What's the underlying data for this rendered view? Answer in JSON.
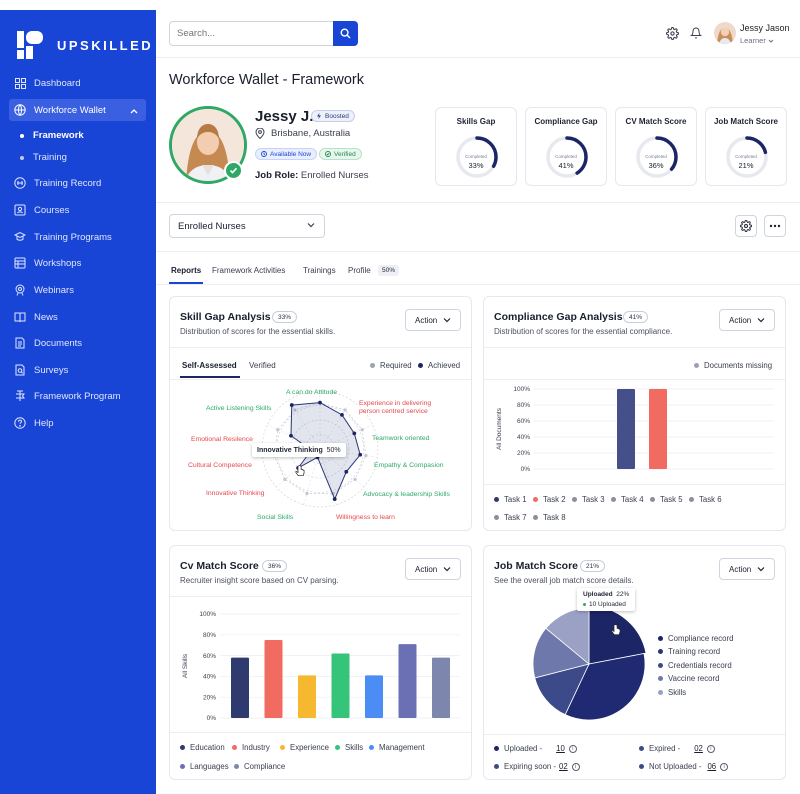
{
  "app": {
    "name": "UPSKILLED"
  },
  "sidebar": {
    "items": [
      {
        "label": "Dashboard",
        "icon": "dashboard-icon"
      },
      {
        "label": "Workforce Wallet",
        "icon": "wallet-icon"
      },
      {
        "label": "Framework"
      },
      {
        "label": "Training"
      },
      {
        "label": "Training Record",
        "icon": "record-icon"
      },
      {
        "label": "Courses",
        "icon": "courses-icon"
      },
      {
        "label": "Training Programs",
        "icon": "programs-icon"
      },
      {
        "label": "Workshops",
        "icon": "workshops-icon"
      },
      {
        "label": "Webinars",
        "icon": "webinars-icon"
      },
      {
        "label": "News",
        "icon": "news-icon"
      },
      {
        "label": "Documents",
        "icon": "documents-icon"
      },
      {
        "label": "Surveys",
        "icon": "surveys-icon"
      },
      {
        "label": "Framework Program",
        "icon": "framework-program-icon"
      },
      {
        "label": "Help",
        "icon": "help-icon"
      }
    ]
  },
  "header": {
    "search_placeholder": "Search...",
    "user": {
      "name": "Jessy Jason",
      "role": "Learner"
    }
  },
  "page": {
    "title": "Workforce Wallet - Framework"
  },
  "profile": {
    "name": "Jessy J.",
    "boosted": "Boosted",
    "location": "Brisbane, Australia",
    "available": "Available Now",
    "verified": "Verified",
    "job_role_label": "Job Role:",
    "job_role": "Enrolled Nurses"
  },
  "gauges": [
    {
      "title": "Skills Gap",
      "caption": "Completed",
      "value": "33%",
      "fraction": 0.33
    },
    {
      "title": "Compliance Gap",
      "caption": "Completed",
      "value": "41%",
      "fraction": 0.41
    },
    {
      "title": "CV Match Score",
      "caption": "Completed",
      "value": "36%",
      "fraction": 0.36
    },
    {
      "title": "Job Match Score",
      "caption": "Completed",
      "value": "21%",
      "fraction": 0.21
    }
  ],
  "filter": {
    "selected": "Enrolled Nurses"
  },
  "tabs": [
    {
      "label": "Reports"
    },
    {
      "label": "Framework Activities"
    },
    {
      "label": "Trainings"
    },
    {
      "label": "Profile",
      "badge": "50%"
    }
  ],
  "skill_gap": {
    "title": "Skill Gap Analysis",
    "badge": "33%",
    "subtitle": "Distribution of scores for the essential skills.",
    "action": "Action",
    "subtabs": [
      "Self-Assessed",
      "Verified"
    ],
    "legend": [
      "Required",
      "Achieved"
    ],
    "tooltip_label": "Innovative Thinking",
    "tooltip_value": "50%",
    "labels": [
      {
        "text": "A can do Attitude",
        "color": "#2fa866"
      },
      {
        "text": "Experience in delivering",
        "color": "#e5484d"
      },
      {
        "text": "person centred service",
        "color": "#e5484d"
      },
      {
        "text": "Teamwork oriented",
        "color": "#2fa866"
      },
      {
        "text": "Empathy & Compasion",
        "color": "#2fa866"
      },
      {
        "text": "Advocacy & leadership Skills",
        "color": "#2fa866"
      },
      {
        "text": "Willingness to learn",
        "color": "#e5484d"
      },
      {
        "text": "Social Skills",
        "color": "#2fa866"
      },
      {
        "text": "Innovative Thinking",
        "color": "#e5484d"
      },
      {
        "text": "Cultural Competence",
        "color": "#e5484d"
      },
      {
        "text": "Emotional Resilence",
        "color": "#e5484d"
      },
      {
        "text": "Active Listening Skills",
        "color": "#2fa866"
      }
    ]
  },
  "compliance_gap": {
    "title": "Compliance Gap Analysis",
    "badge": "41%",
    "subtitle": "Distribution of scores for the essential compliance.",
    "action": "Action",
    "legend_top": "Documents missing",
    "legend": [
      {
        "name": "Task 1",
        "color": "#2f3a6e"
      },
      {
        "name": "Task 2",
        "color": "#f26b60"
      },
      {
        "name": "Task 3",
        "color": "#8a8f9c"
      },
      {
        "name": "Task 4",
        "color": "#8a8f9c"
      },
      {
        "name": "Task 5",
        "color": "#8a8f9c"
      },
      {
        "name": "Task 6",
        "color": "#8a8f9c"
      },
      {
        "name": "Task 7",
        "color": "#8a8f9c"
      },
      {
        "name": "Task 8",
        "color": "#8a8f9c"
      }
    ]
  },
  "cv_match": {
    "title": "Cv Match Score",
    "badge": "36%",
    "subtitle": "Recruiter insight score based on CV parsing.",
    "action": "Action",
    "legend": [
      {
        "name": "Education",
        "color": "#2f3a6e"
      },
      {
        "name": "Industry",
        "color": "#f26b60"
      },
      {
        "name": "Experience",
        "color": "#f5b82e"
      },
      {
        "name": "Skills",
        "color": "#35c47a"
      },
      {
        "name": "Management",
        "color": "#4c8cf5"
      },
      {
        "name": "Languages",
        "color": "#6b70b5"
      },
      {
        "name": "Compliance",
        "color": "#7d86ad"
      }
    ]
  },
  "job_match": {
    "title": "Job Match Score",
    "badge": "21%",
    "subtitle": "See the overall job match score details.",
    "action": "Action",
    "tooltip_title": "Uploaded",
    "tooltip_pct": "22%",
    "tooltip_detail": "10 Uploaded",
    "legend": [
      {
        "name": "Compliance record",
        "color": "#1c2566"
      },
      {
        "name": "Training record",
        "color": "#2a3575"
      },
      {
        "name": "Credentials record",
        "color": "#3d4a8a"
      },
      {
        "name": "Vaccine record",
        "color": "#6f78aa"
      },
      {
        "name": "Skills",
        "color": "#9aa1c4"
      }
    ],
    "stats": [
      {
        "label": "Uploaded -",
        "value": "10",
        "color": "#1c2566"
      },
      {
        "label": "Expired -",
        "value": "02",
        "color": "#3d4a8a"
      },
      {
        "label": "Expiring soon -",
        "value": "02",
        "color": "#3d4a8a"
      },
      {
        "label": "Not Uploaded -",
        "value": "06",
        "color": "#3d4a8a"
      }
    ]
  },
  "chart_data": [
    {
      "type": "radar",
      "title": "Skill Gap Analysis",
      "categories": [
        "A can do Attitude",
        "Experience in delivering person centred service",
        "Teamwork oriented",
        "Empathy & Compasion",
        "Advocacy & leadership Skills",
        "Willingness to learn",
        "Social Skills",
        "Innovative Thinking",
        "Cultural Competence",
        "Emotional Resilence",
        "Active Listening Skills"
      ],
      "series": [
        {
          "name": "Required",
          "values": [
            80,
            80,
            80,
            80,
            80,
            80,
            80,
            80,
            80,
            80,
            80
          ]
        },
        {
          "name": "Achieved",
          "values": [
            80,
            70,
            65,
            70,
            60,
            90,
            15,
            50,
            15,
            55,
            90
          ]
        }
      ]
    },
    {
      "type": "bar",
      "title": "Compliance Gap Analysis",
      "ylabel": "All Documents",
      "categories": [
        "Task 1",
        "Task 2",
        "Task 3",
        "Task 4",
        "Task 5",
        "Task 6",
        "Task 7",
        "Task 8"
      ],
      "values": [
        100,
        100,
        0,
        0,
        0,
        0,
        0,
        0
      ],
      "ylim": [
        0,
        100
      ],
      "yticks": [
        "0%",
        "20%",
        "40%",
        "60%",
        "80%",
        "100%"
      ]
    },
    {
      "type": "bar",
      "title": "Cv Match Score",
      "ylabel": "All Skills",
      "categories": [
        "Education",
        "Industry",
        "Experience",
        "Skills",
        "Management",
        "Languages",
        "Compliance"
      ],
      "values": [
        58,
        75,
        41,
        62,
        41,
        71,
        58
      ],
      "ylim": [
        0,
        100
      ],
      "yticks": [
        "0%",
        "20%",
        "40%",
        "60%",
        "80%",
        "100%"
      ]
    },
    {
      "type": "pie",
      "title": "Job Match Score",
      "categories": [
        "Compliance record",
        "Training record",
        "Credentials record",
        "Vaccine record",
        "Skills"
      ],
      "values": [
        22,
        35,
        14,
        15,
        14
      ]
    }
  ],
  "colors": {
    "brand": "#1945d6",
    "green": "#2fa866",
    "navy": "#2f3a6e",
    "coral": "#f26b60"
  }
}
